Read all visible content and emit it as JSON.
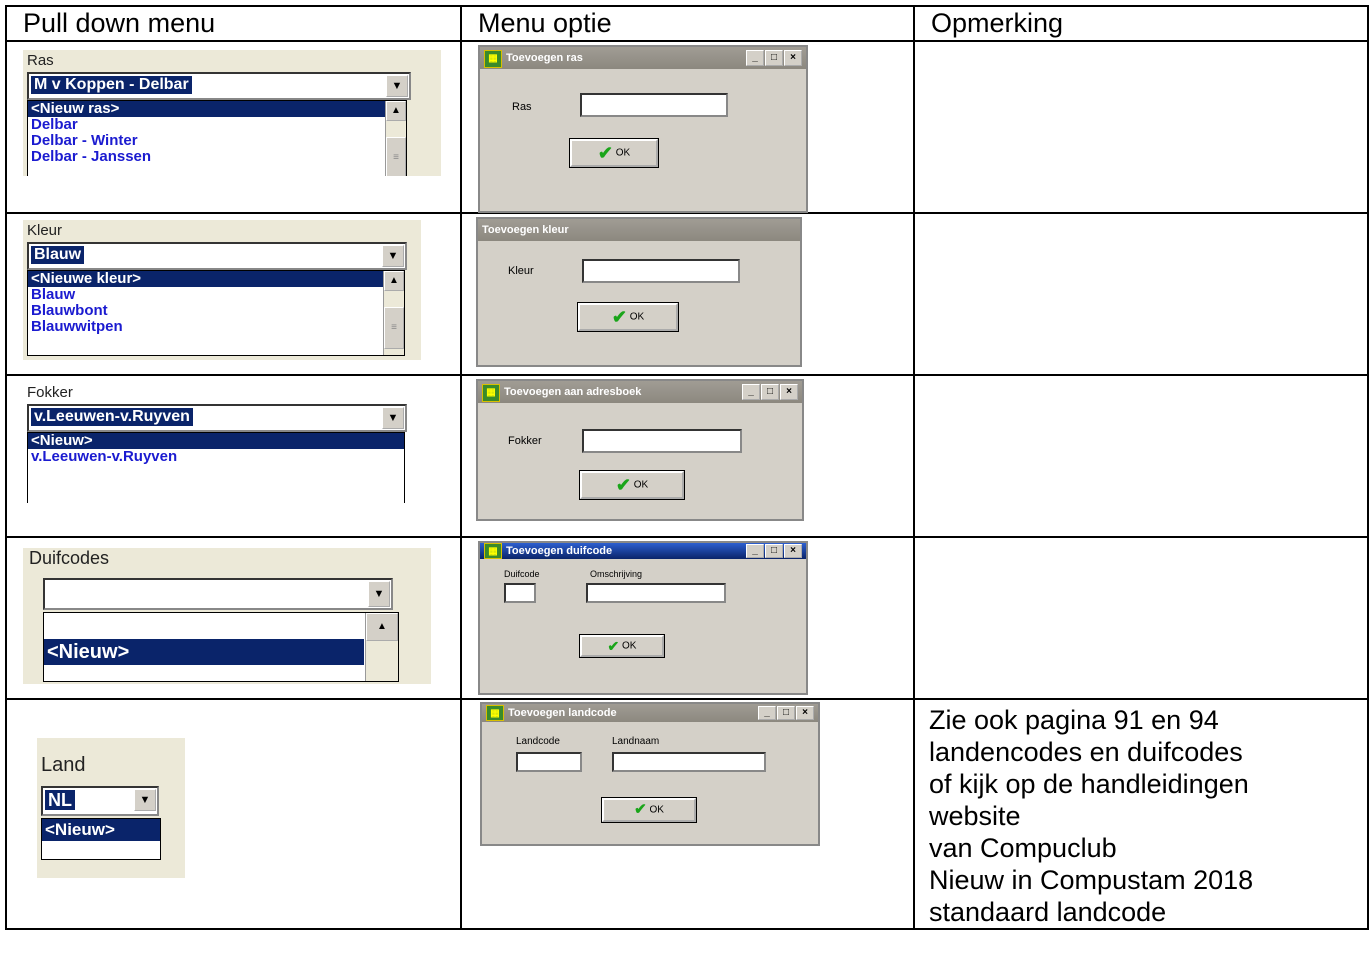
{
  "headers": {
    "col1": "Pull down menu",
    "col2": "Menu optie",
    "col3": "Opmerking"
  },
  "rows": [
    {
      "pulldown": {
        "label": "Ras",
        "selected": "M v Koppen - Delbar",
        "items": [
          "<Nieuw ras>",
          "Delbar",
          "Delbar -  Winter",
          "Delbar - Janssen"
        ]
      },
      "dialog": {
        "title": "Toevoegen ras",
        "fields": [
          "Ras"
        ],
        "ok": "OK"
      }
    },
    {
      "pulldown": {
        "label": "Kleur",
        "selected": "Blauw",
        "items": [
          "<Nieuwe kleur>",
          "Blauw",
          "Blauwbont",
          "Blauwwitpen"
        ]
      },
      "dialog": {
        "title": "Toevoegen kleur",
        "fields": [
          "Kleur"
        ],
        "ok": "OK"
      }
    },
    {
      "pulldown": {
        "label": "Fokker",
        "selected": "v.Leeuwen-v.Ruyven",
        "items": [
          "<Nieuw>",
          "v.Leeuwen-v.Ruyven"
        ]
      },
      "dialog": {
        "title": "Toevoegen aan adresboek",
        "fields": [
          "Fokker"
        ],
        "ok": "OK"
      }
    },
    {
      "pulldown": {
        "label": "Duifcodes",
        "selected": "",
        "items": [
          "",
          "<Nieuw>"
        ]
      },
      "dialog": {
        "title": "Toevoegen duifcode",
        "fields": [
          "Duifcode",
          "Omschrijving"
        ],
        "ok": "OK"
      }
    },
    {
      "pulldown": {
        "label": "Land",
        "selected": "NL",
        "items": [
          "<Nieuw>"
        ]
      },
      "dialog": {
        "title": "Toevoegen landcode",
        "fields": [
          "Landcode",
          "Landnaam"
        ],
        "ok": "OK"
      },
      "note": [
        "Zie ook pagina 91 en 94",
        "landencodes en duifcodes",
        "of kijk op de handleidingen",
        "website",
        "van Compuclub",
        "Nieuw in Compustam 2018",
        "standaard landcode"
      ]
    }
  ]
}
